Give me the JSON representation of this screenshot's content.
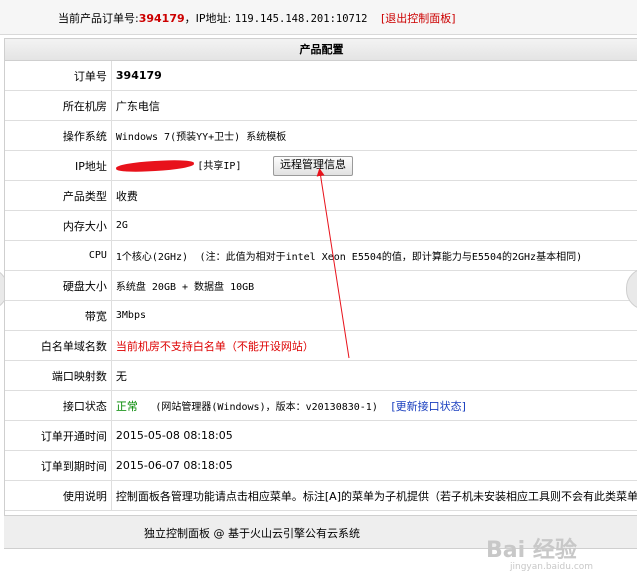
{
  "topbar": {
    "order_label": "当前产品订单号:",
    "order_number": "394179",
    "ip_label": "，IP地址:",
    "ip_value": "119.145.148.201:10712",
    "exit_label": "[退出控制面板]"
  },
  "panel": {
    "title": "产品配置",
    "rows": [
      {
        "label": "订单号",
        "value": "394179"
      },
      {
        "label": "所在机房",
        "value": "广东电信"
      },
      {
        "label": "操作系统",
        "value": "Windows 7(预装YY+卫士) 系统模板"
      },
      {
        "label": "IP地址",
        "value": "[共享IP]",
        "button": "远程管理信息"
      },
      {
        "label": "产品类型",
        "value": "收费"
      },
      {
        "label": "内存大小",
        "value": "2G"
      },
      {
        "label": "CPU",
        "value": "1个核心(2GHz)",
        "note": "(注：此值为相对于intel Xeon E5504的值，即计算能力与E5504的2GHz基本相同)"
      },
      {
        "label": "硬盘大小",
        "value": "系统盘 20GB + 数据盘 10GB"
      },
      {
        "label": "带宽",
        "value": "3Mbps"
      },
      {
        "label": "白名单域名数",
        "value": "当前机房不支持白名单（不能开设网站）"
      },
      {
        "label": "端口映射数",
        "value": "无"
      },
      {
        "label": "接口状态",
        "value": "正常",
        "note": "(网站管理器(Windows)，版本：v20130830-1)",
        "link": "[更新接口状态]"
      },
      {
        "label": "订单开通时间",
        "value": "2015-05-08 08:18:05"
      },
      {
        "label": "订单到期时间",
        "value": "2015-06-07 08:18:05"
      },
      {
        "label": "使用说明",
        "value": "控制面板各管理功能请点击相应菜单。标注[A]的菜单为子机提供（若子机未安装相应工具则不会有此类菜单"
      }
    ]
  },
  "footer": {
    "text": "独立控制面板 @ 基于火山云引擎公有云系统"
  },
  "watermark": {
    "text": "Bai 经验",
    "url": "jingyan.baidu.com"
  },
  "colors": {
    "accent_red": "#dd0000",
    "ok_green": "#008800",
    "link_blue": "#1a3fbf",
    "annotation_red": "#e8121b"
  }
}
